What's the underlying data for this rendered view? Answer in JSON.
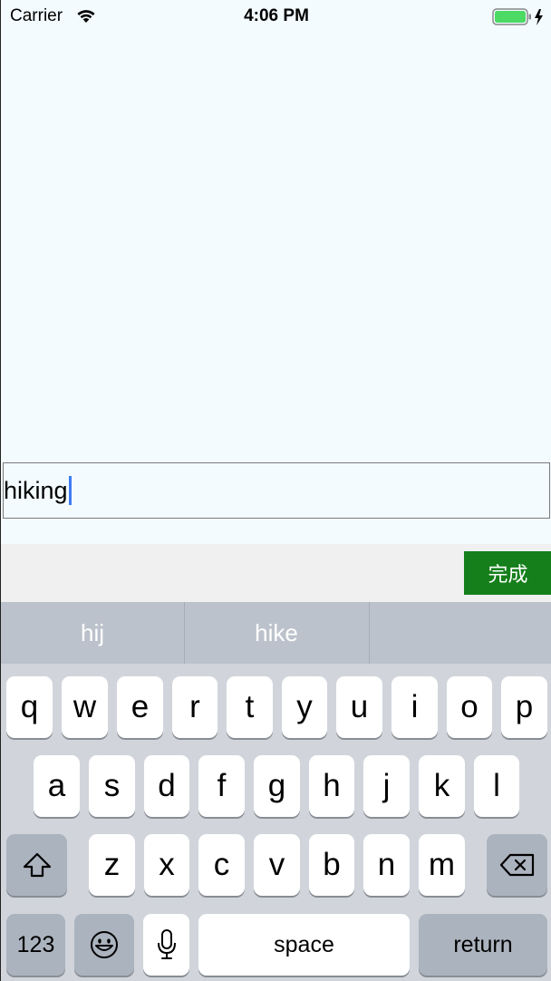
{
  "status_bar": {
    "carrier": "Carrier",
    "time": "4:06 PM",
    "wifi_icon": "wifi-icon",
    "battery_icon": "battery-charging-icon",
    "battery_color": "#4cd964"
  },
  "text_field": {
    "value": "hiking",
    "caret_color": "#3f7bf3"
  },
  "accessory_bar": {
    "done_label": "完成",
    "done_color": "#157f1b"
  },
  "keyboard": {
    "suggestions": [
      "hij",
      "hike",
      ""
    ],
    "row1": [
      "q",
      "w",
      "e",
      "r",
      "t",
      "y",
      "u",
      "i",
      "o",
      "p"
    ],
    "row2": [
      "a",
      "s",
      "d",
      "f",
      "g",
      "h",
      "j",
      "k",
      "l"
    ],
    "row3": [
      "z",
      "x",
      "c",
      "v",
      "b",
      "n",
      "m"
    ],
    "shift_icon": "shift-icon",
    "delete_icon": "delete-backspace-icon",
    "numbers_label": "123",
    "emoji_icon": "emoji-icon",
    "mic_icon": "microphone-icon",
    "space_label": "space",
    "return_label": "return"
  }
}
